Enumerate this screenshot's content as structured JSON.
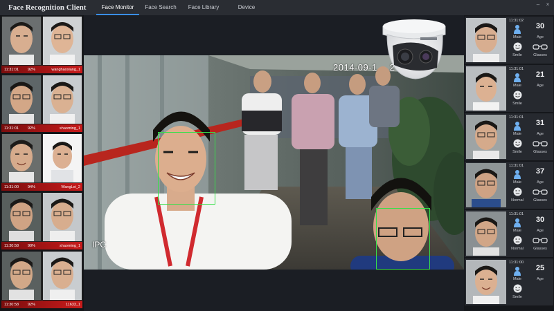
{
  "app": {
    "title": "Face Recognition Client"
  },
  "tabs": [
    {
      "label": "Face Monitor",
      "active": true
    },
    {
      "label": "Face Search",
      "active": false
    },
    {
      "label": "Face Library",
      "active": false
    },
    {
      "label": "Device",
      "active": false
    }
  ],
  "window_controls": {
    "minimize": "–",
    "close": "×"
  },
  "captures": [
    {
      "time": "11:31:01",
      "similarity": "92%",
      "name": "wanghaoxiang_1"
    },
    {
      "time": "11:31:01",
      "similarity": "92%",
      "name": "shaoming_1"
    },
    {
      "time": "11:31:00",
      "similarity": "94%",
      "name": "WangLei_2"
    },
    {
      "time": "11:30:58",
      "similarity": "90%",
      "name": "shaoming_1"
    },
    {
      "time": "11:30:58",
      "similarity": "92%",
      "name": "11633_1"
    }
  ],
  "video": {
    "timestamp": "2014-09-1",
    "timestamp_suffix": "2",
    "osd_label": "IPC"
  },
  "attributes": [
    {
      "time": "11:31:02",
      "gender": "Male",
      "age": "30",
      "age_label": "Age",
      "expression": "Smile",
      "glasses": "Glasses",
      "has_glasses": true
    },
    {
      "time": "11:31:01",
      "gender": "Male",
      "age": "21",
      "age_label": "Age",
      "expression": "Smile",
      "glasses": "",
      "has_glasses": false
    },
    {
      "time": "11:31:01",
      "gender": "Male",
      "age": "31",
      "age_label": "Age",
      "expression": "Smile",
      "glasses": "Glasses",
      "has_glasses": true
    },
    {
      "time": "11:31:01",
      "gender": "Male",
      "age": "37",
      "age_label": "Age",
      "expression": "Normal",
      "glasses": "Glasses",
      "has_glasses": true
    },
    {
      "time": "11:31:01",
      "gender": "Male",
      "age": "30",
      "age_label": "Age",
      "expression": "Normal",
      "glasses": "Glasses",
      "has_glasses": true
    },
    {
      "time": "11:31:00",
      "gender": "Male",
      "age": "25",
      "age_label": "Age",
      "expression": "Smile",
      "glasses": "",
      "has_glasses": false
    }
  ],
  "colors": {
    "accent": "#3a8ee6",
    "capture_bar": "#c81b1b",
    "detect_box": "#36e04a",
    "panel_bg": "#26292f"
  }
}
